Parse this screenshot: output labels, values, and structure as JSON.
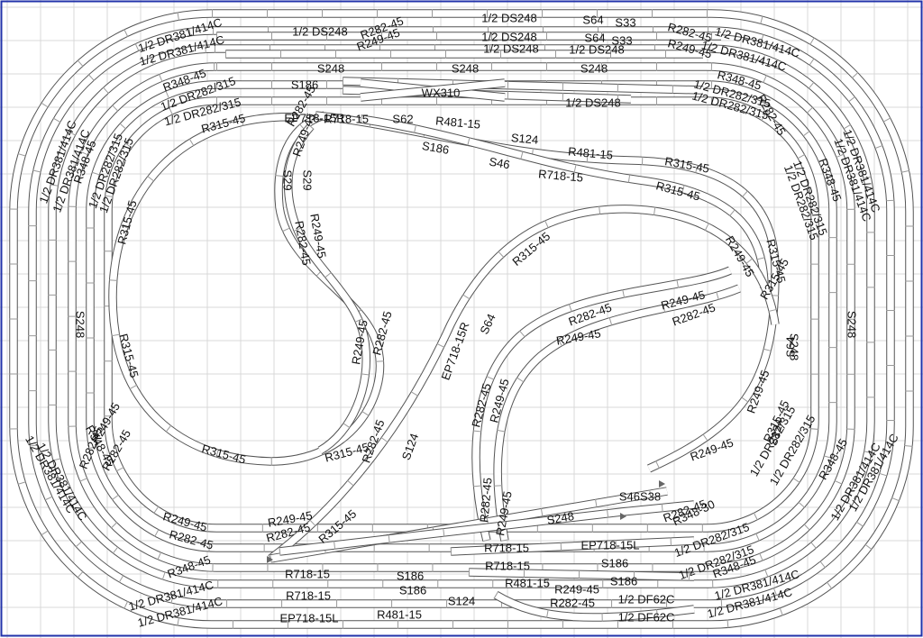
{
  "colors": {
    "grid": "#d9d9d9",
    "rail": "#555555",
    "border": "#2233aa",
    "bumper": "#666666"
  },
  "labels": [
    "1/2 DS248",
    "1/2 DS248",
    "1/2 DS248",
    "1/2 DS248",
    "1/2 DS248",
    "1/2 DS248",
    "S248",
    "S248",
    "S248",
    "S248",
    "S248",
    "S248",
    "S248",
    "S64",
    "S33",
    "S64",
    "S33",
    "S64",
    "S64",
    "R282-45",
    "R282-45",
    "R282-45",
    "R282-45",
    "R282-45",
    "R282-45",
    "R282-45",
    "R282-45",
    "R282-45",
    "R282-45",
    "R282-45",
    "R282-45",
    "R282-45",
    "R282-45",
    "R282-45",
    "R282-45",
    "R282-45",
    "R249-45",
    "R249-45",
    "R249-45",
    "R249-45",
    "R249-45",
    "R249-45",
    "R249-45",
    "R249-45",
    "R249-45",
    "R249-45",
    "R249-45",
    "R249-45",
    "R249-45",
    "R249-45",
    "R249-45",
    "R249-45",
    "1/2 DR381/414C",
    "1/2 DR381/414C",
    "1/2 DR381/414C",
    "1/2 DR381/414C",
    "1/2 DR381/414C",
    "1/2 DR381/414C",
    "1/2 DR381/414C",
    "1/2 DR381/414C",
    "1/2 DR381/414C",
    "1/2 DR381/414C",
    "1/2 DR381/414C",
    "1/2 DR381/414C",
    "1/2 DR381/414C",
    "1/2 DR381/414C",
    "1/2 DR381/414C",
    "1/2 DR381/414C",
    "R348-45",
    "R348-45",
    "R348-45",
    "R348-45",
    "R348-45",
    "R348-45",
    "R348-45",
    "R348-45",
    "R348-30",
    "1/2 DR282/315",
    "1/2 DR282/315",
    "1/2 DR282/315",
    "1/2 DR282/315",
    "1/2 DR282/315",
    "1/2 DR282/315",
    "1/2 DR282/315",
    "1/2 DR282/315",
    "1/2 DR282/315",
    "1/2 DR282/315",
    "1/2 DR282/315",
    "1/2 DR282/315",
    "S186",
    "S186",
    "S186",
    "S186",
    "S186",
    "S186",
    "WX310",
    "EP718-15R",
    "EP718-15R",
    "EP718-15L",
    "EP718-15L",
    "S62",
    "R481-15",
    "R481-15",
    "R481-15",
    "R481-15",
    "S124",
    "S124",
    "S124",
    "S124",
    "R315-45",
    "R315-45",
    "R315-45",
    "R315-45",
    "R315-45",
    "R315-45",
    "R315-45",
    "R315-45",
    "R315-45",
    "R315-45",
    "R315-45",
    "R315-45",
    "R718-15",
    "R718-15",
    "R718-15",
    "R718-15",
    "R718-15",
    "R718-15",
    "S46",
    "S46S38",
    "S29",
    "S29",
    "1/2 DF62C",
    "1/2 DF62C"
  ]
}
